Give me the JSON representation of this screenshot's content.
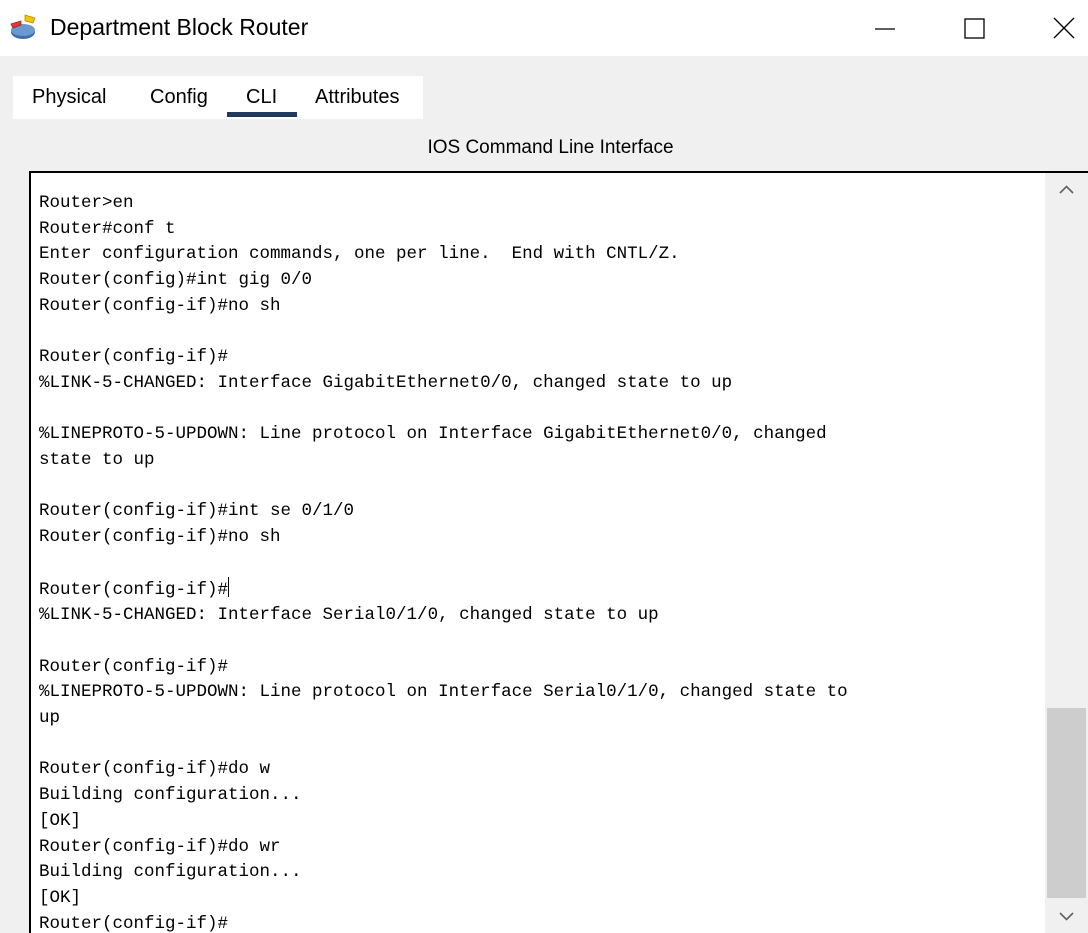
{
  "window": {
    "title": "Department Block Router",
    "icon": "router-app-icon",
    "controls": [
      "minimize-icon",
      "maximize-icon",
      "close-icon"
    ]
  },
  "tabs": [
    {
      "label": "Physical",
      "active": false
    },
    {
      "label": "Config",
      "active": false
    },
    {
      "label": "CLI",
      "active": true
    },
    {
      "label": "Attributes",
      "active": false
    }
  ],
  "cli": {
    "heading": "IOS Command Line Interface",
    "lines": [
      "Router>en",
      "Router#conf t",
      "Enter configuration commands, one per line.  End with CNTL/Z.",
      "Router(config)#int gig 0/0",
      "Router(config-if)#no sh",
      "",
      "Router(config-if)#",
      "%LINK-5-CHANGED: Interface GigabitEthernet0/0, changed state to up",
      "",
      "%LINEPROTO-5-UPDOWN: Line protocol on Interface GigabitEthernet0/0, changed",
      "state to up",
      "",
      "Router(config-if)#int se 0/1/0",
      "Router(config-if)#no sh",
      "",
      "Router(config-if)#",
      "%LINK-5-CHANGED: Interface Serial0/1/0, changed state to up",
      "",
      "Router(config-if)#",
      "%LINEPROTO-5-UPDOWN: Line protocol on Interface Serial0/1/0, changed state to",
      "up",
      "",
      "Router(config-if)#do w",
      "Building configuration...",
      "[OK]",
      "Router(config-if)#do wr",
      "Building configuration...",
      "[OK]",
      "Router(config-if)#"
    ],
    "caret_line_index": 15
  },
  "scrollbar": {
    "position_fraction": 1.0
  },
  "colors": {
    "tab_underline": "#1f3a5c",
    "scroll_thumb": "#cdcdcd"
  }
}
